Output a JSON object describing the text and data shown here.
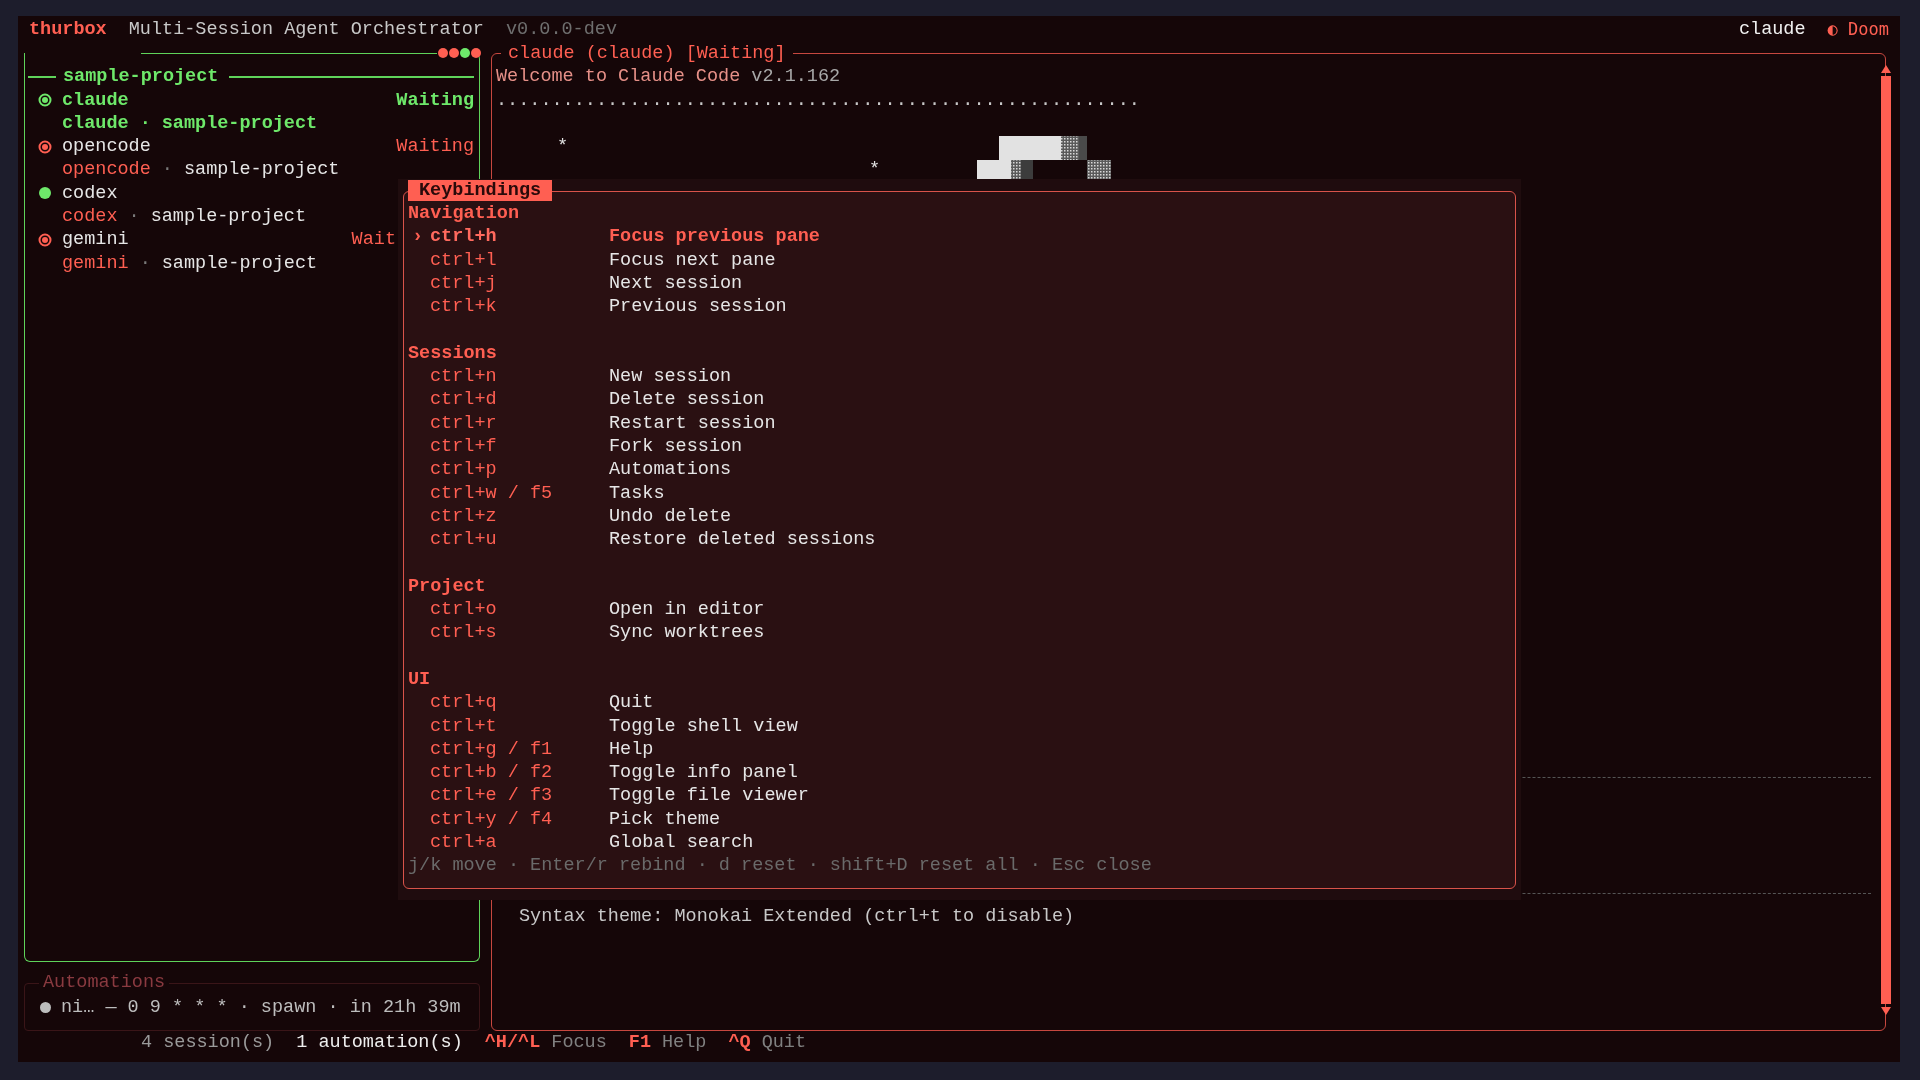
{
  "header": {
    "app_name": "thurbox",
    "title": "Multi-Session Agent Orchestrator",
    "version": "v0.0.0-dev",
    "agent": "claude",
    "theme_icon": "◐",
    "theme": "Doom"
  },
  "sidebar": {
    "indicators": [
      {
        "color": "#ff5f52"
      },
      {
        "color": "#ff5f52"
      },
      {
        "color": "#6ee86a"
      },
      {
        "color": "#ff5f52"
      }
    ],
    "project": "sample-project",
    "sessions": [
      {
        "name": "claude",
        "status": "Waiting",
        "agent": "claude",
        "separator": "·",
        "project": "sample-project",
        "selected": true,
        "kind": "ring",
        "color": "#6ee86a"
      },
      {
        "name": "opencode",
        "status": "Waiting",
        "agent": "opencode",
        "separator": "·",
        "project": "sample-project",
        "selected": false,
        "kind": "ring",
        "color": "#ff5f52"
      },
      {
        "name": "codex",
        "agent": "codex",
        "separator": "·",
        "project": "sample-project",
        "selected": false,
        "kind": "solid",
        "color": "#6ee86a"
      },
      {
        "name": "gemini",
        "status": "Wait",
        "agent": "gemini",
        "separator": "·",
        "project": "sample-project",
        "selected": false,
        "kind": "ring",
        "color": "#ff5f52"
      }
    ]
  },
  "automations": {
    "title": "Automations",
    "items": [
      {
        "text": "ni… — 0 9 * * * · spawn · in 21h 39m",
        "color": "#bdbdbd"
      }
    ]
  },
  "main_pane": {
    "title": "claude (claude) [Waiting]",
    "welcome": "Welcome to Claude Code",
    "version": "v2.1.162",
    "rule": "..........................................................",
    "marks": [
      "*",
      "*"
    ],
    "note": "Syntax theme: Monokai Extended (ctrl+t to disable)"
  },
  "keybindings": {
    "title": "Keybindings",
    "cursor": "›",
    "sections": [
      {
        "title": "Navigation",
        "items": [
          {
            "keys": "ctrl+h",
            "action": "Focus previous pane",
            "selected": true
          },
          {
            "keys": "ctrl+l",
            "action": "Focus next pane",
            "selected": false
          },
          {
            "keys": "ctrl+j",
            "action": "Next session",
            "selected": false
          },
          {
            "keys": "ctrl+k",
            "action": "Previous session",
            "selected": false
          }
        ]
      },
      {
        "title": "Sessions",
        "items": [
          {
            "keys": "ctrl+n",
            "action": "New session",
            "selected": false
          },
          {
            "keys": "ctrl+d",
            "action": "Delete session",
            "selected": false
          },
          {
            "keys": "ctrl+r",
            "action": "Restart session",
            "selected": false
          },
          {
            "keys": "ctrl+f",
            "action": "Fork session",
            "selected": false
          },
          {
            "keys": "ctrl+p",
            "action": "Automations",
            "selected": false
          },
          {
            "keys": "ctrl+w / f5",
            "action": "Tasks",
            "selected": false
          },
          {
            "keys": "ctrl+z",
            "action": "Undo delete",
            "selected": false
          },
          {
            "keys": "ctrl+u",
            "action": "Restore deleted sessions",
            "selected": false
          }
        ]
      },
      {
        "title": "Project",
        "items": [
          {
            "keys": "ctrl+o",
            "action": "Open in editor",
            "selected": false
          },
          {
            "keys": "ctrl+s",
            "action": "Sync worktrees",
            "selected": false
          }
        ]
      },
      {
        "title": "UI",
        "items": [
          {
            "keys": "ctrl+q",
            "action": "Quit",
            "selected": false
          },
          {
            "keys": "ctrl+t",
            "action": "Toggle shell view",
            "selected": false
          },
          {
            "keys": "ctrl+g / f1",
            "action": "Help",
            "selected": false
          },
          {
            "keys": "ctrl+b / f2",
            "action": "Toggle info panel",
            "selected": false
          },
          {
            "keys": "ctrl+e / f3",
            "action": "Toggle file viewer",
            "selected": false
          },
          {
            "keys": "ctrl+y / f4",
            "action": "Pick theme",
            "selected": false
          },
          {
            "keys": "ctrl+a",
            "action": "Global search",
            "selected": false
          }
        ]
      }
    ],
    "footer": "j/k move · Enter/r rebind · d reset · shift+D reset all · Esc close"
  },
  "status_bar": {
    "sessions": "4 session(s)",
    "automations": "1 automation(s)",
    "hints": [
      {
        "keys": "^H/^L",
        "label": "Focus"
      },
      {
        "keys": "F1",
        "label": "Help"
      },
      {
        "keys": "^Q",
        "label": "Quit"
      }
    ]
  }
}
